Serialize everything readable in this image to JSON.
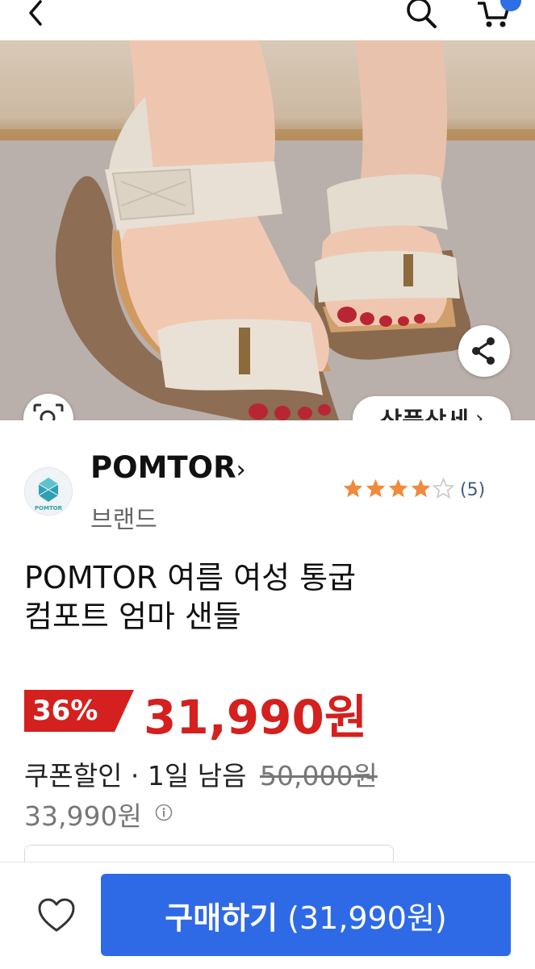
{
  "header": {
    "icons": [
      "back-arrow-icon",
      "search-icon",
      "cart-icon"
    ],
    "accent": "#2f6fe6"
  },
  "hero": {
    "detail_button_label": "상품상세",
    "detail_button_chevron": "›",
    "carousel_dots": 2,
    "active_dot": 2,
    "icons": [
      "zoom-icon",
      "share-icon"
    ]
  },
  "brand": {
    "name": "POMTOR",
    "chevron": "›",
    "sub": "브랜드",
    "logo_text": "POMTOR",
    "rating": 4,
    "rating_max": 5,
    "review_count": "(5)"
  },
  "product": {
    "title_line1": "POMTOR 여름 여성 통굽",
    "title_line2": "컴포트 엄마 샌들",
    "discount": "36%",
    "price": "31,990원",
    "coupon_label": "쿠폰할인 · 1일 남음",
    "original_price": "50,000원",
    "alt_price": "33,990원",
    "price_color": "#d4201e"
  },
  "bottom": {
    "buy_label": "구매하기",
    "buy_price": "(31,990원)",
    "button_color": "#2f6ae6"
  }
}
